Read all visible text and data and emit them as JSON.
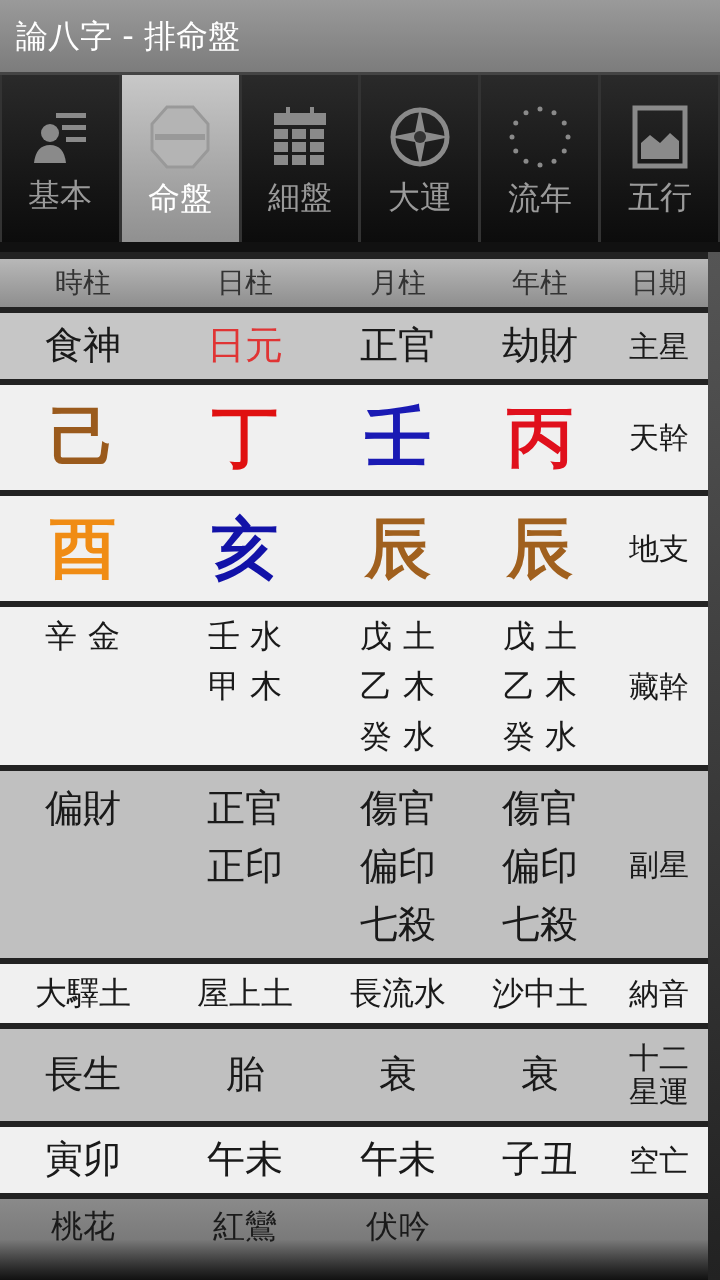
{
  "title": "論八字 - 排命盤",
  "tabs": [
    {
      "label": "基本",
      "selected": false
    },
    {
      "label": "命盤",
      "selected": true
    },
    {
      "label": "細盤",
      "selected": false
    },
    {
      "label": "大運",
      "selected": false
    },
    {
      "label": "流年",
      "selected": false
    },
    {
      "label": "五行",
      "selected": false
    }
  ],
  "table": {
    "columns": [
      "時柱",
      "日柱",
      "月柱",
      "年柱",
      "日期"
    ],
    "rows": [
      {
        "kind": "star",
        "label": "主星",
        "cells": [
          {
            "lines": [
              "食神"
            ]
          },
          {
            "lines": [
              "日元"
            ],
            "color": "#e03434"
          },
          {
            "lines": [
              "正官"
            ]
          },
          {
            "lines": [
              "劫財"
            ]
          }
        ]
      },
      {
        "kind": "pillar",
        "label": "天幹",
        "cells": [
          {
            "lines": [
              "己"
            ],
            "color": "#9a5a1c"
          },
          {
            "lines": [
              "丁"
            ],
            "color": "#e01010"
          },
          {
            "lines": [
              "壬"
            ],
            "color": "#1a1ab4"
          },
          {
            "lines": [
              "丙"
            ],
            "color": "#e0101c"
          }
        ]
      },
      {
        "kind": "pillar",
        "label": "地支",
        "cells": [
          {
            "lines": [
              "酉"
            ],
            "color": "#f08c14"
          },
          {
            "lines": [
              "亥"
            ],
            "color": "#1212a8"
          },
          {
            "lines": [
              "辰"
            ],
            "color": "#a0601e"
          },
          {
            "lines": [
              "辰"
            ],
            "color": "#a0601e"
          }
        ]
      },
      {
        "kind": "hidden",
        "label": "藏幹",
        "cells": [
          {
            "lines": [
              "辛 金"
            ]
          },
          {
            "lines": [
              "壬 水",
              "甲 木"
            ]
          },
          {
            "lines": [
              "戊 土",
              "乙 木",
              "癸 水"
            ]
          },
          {
            "lines": [
              "戊 土",
              "乙 木",
              "癸 水"
            ]
          }
        ]
      },
      {
        "kind": "sub",
        "label": "副星",
        "cells": [
          {
            "lines": [
              "偏財"
            ]
          },
          {
            "lines": [
              "正官",
              "正印"
            ]
          },
          {
            "lines": [
              "傷官",
              "偏印",
              "七殺"
            ]
          },
          {
            "lines": [
              "傷官",
              "偏印",
              "七殺"
            ]
          }
        ]
      },
      {
        "kind": "nayin",
        "label": "納音",
        "cells": [
          {
            "lines": [
              "大驛土"
            ]
          },
          {
            "lines": [
              "屋上土"
            ]
          },
          {
            "lines": [
              "長流水"
            ]
          },
          {
            "lines": [
              "沙中土"
            ]
          }
        ]
      },
      {
        "kind": "fortune",
        "label": "十二星運",
        "cells": [
          {
            "lines": [
              "長生"
            ]
          },
          {
            "lines": [
              "胎"
            ]
          },
          {
            "lines": [
              "衰"
            ]
          },
          {
            "lines": [
              "衰"
            ]
          }
        ]
      },
      {
        "kind": "void",
        "label": "空亡",
        "cells": [
          {
            "lines": [
              "寅卯"
            ]
          },
          {
            "lines": [
              "午未"
            ]
          },
          {
            "lines": [
              "午未"
            ]
          },
          {
            "lines": [
              "子丑"
            ]
          }
        ]
      },
      {
        "kind": "extra",
        "cells": [
          {
            "lines": [
              "桃花"
            ]
          },
          {
            "lines": [
              "紅鸞"
            ]
          },
          {
            "lines": [
              "伏吟"
            ]
          }
        ]
      }
    ]
  }
}
